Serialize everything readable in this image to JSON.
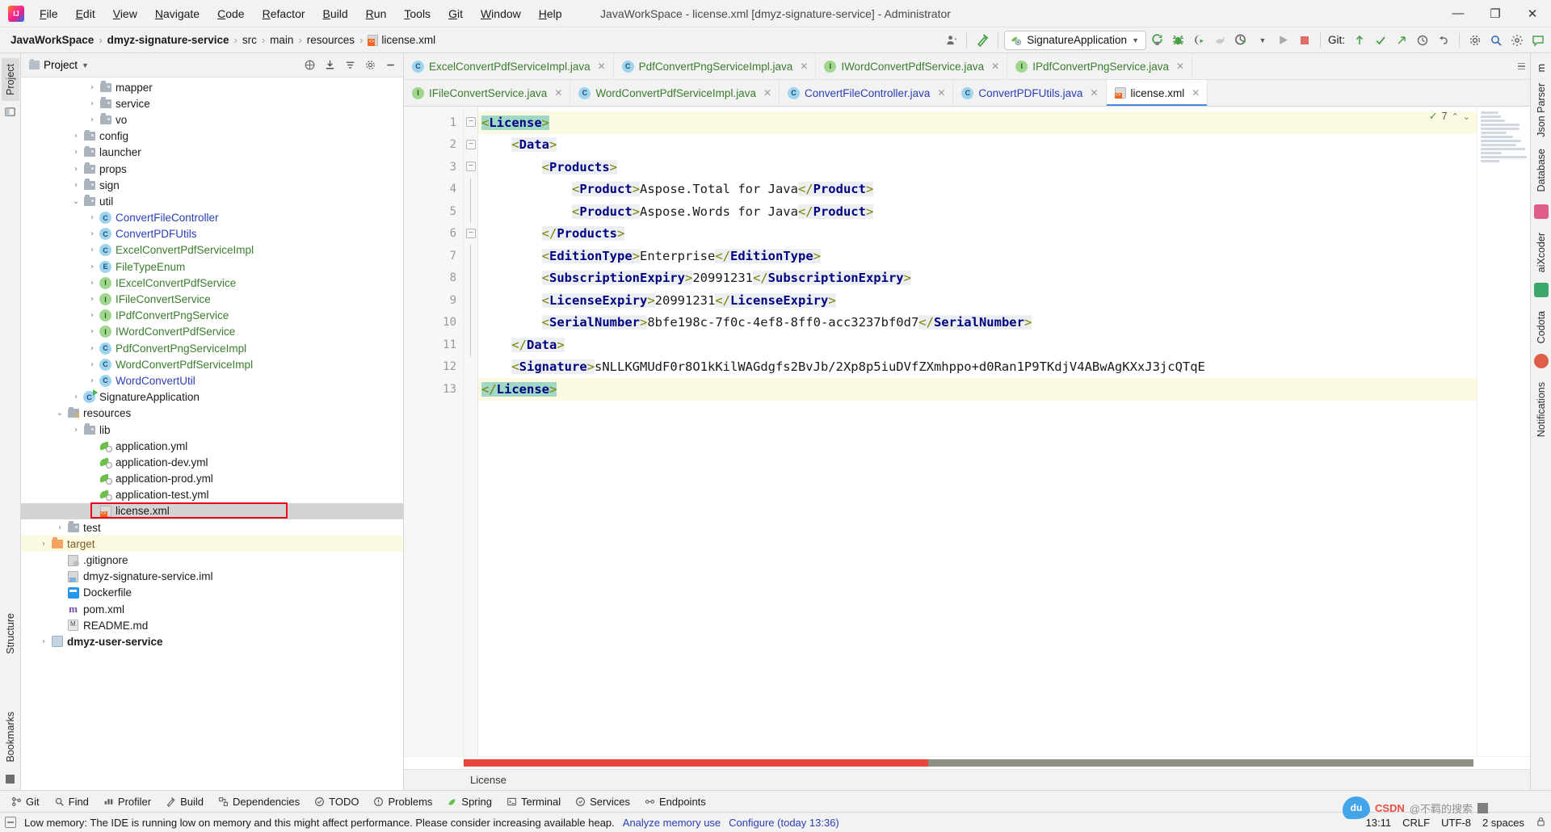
{
  "titlebar": {
    "logo_alt": "intellij-idea-logo",
    "window_title": "JavaWorkSpace - license.xml [dmyz-signature-service] - Administrator",
    "menus": [
      {
        "label": "File"
      },
      {
        "label": "Edit"
      },
      {
        "label": "View"
      },
      {
        "label": "Navigate"
      },
      {
        "label": "Code"
      },
      {
        "label": "Refactor"
      },
      {
        "label": "Build"
      },
      {
        "label": "Run"
      },
      {
        "label": "Tools"
      },
      {
        "label": "Git"
      },
      {
        "label": "Window"
      },
      {
        "label": "Help"
      }
    ],
    "window_buttons": {
      "minimize": "—",
      "maximize": "❐",
      "close": "✕"
    }
  },
  "navbar": {
    "breadcrumbs": [
      {
        "label": "JavaWorkSpace",
        "bold": true
      },
      {
        "label": "dmyz-signature-service",
        "bold": true
      },
      {
        "label": "src",
        "bold": false
      },
      {
        "label": "main",
        "bold": false
      },
      {
        "label": "resources",
        "bold": false
      },
      {
        "label": "license.xml",
        "bold": false,
        "icon": "xml-file-icon"
      }
    ],
    "separator": "›",
    "run_config": "SignatureApplication",
    "git_label": "Git:",
    "icons": [
      "user-avatar-icon",
      "hammer-build-icon",
      "rerun-icon",
      "debug-bug-icon",
      "coverage-icon",
      "profiler-icon",
      "run-with-dropdown-icon",
      "run-icon",
      "stop-icon",
      "git-update-icon",
      "git-commit-icon",
      "git-push-icon",
      "history-icon",
      "undo-icon",
      "settings-gear-icon",
      "search-everywhere-icon",
      "ide-settings-icon",
      "feedback-icon"
    ]
  },
  "left_strip": {
    "tabs": [
      {
        "label": "Project",
        "selected": true,
        "icon": "project-icon"
      },
      {
        "label": "Bookmarks",
        "selected": false,
        "icon": "bookmark-icon"
      },
      {
        "label": "Structure",
        "selected": false,
        "icon": "structure-icon"
      }
    ]
  },
  "right_strip": {
    "tabs": [
      {
        "label": "m",
        "icon": "maven-icon"
      },
      {
        "label": "Json Parser",
        "icon": "json-parser-icon"
      },
      {
        "label": "Database",
        "icon": "database-icon"
      },
      {
        "label": "aiXcoder",
        "icon": "aixcoder-icon"
      },
      {
        "label": "Codota",
        "icon": "codota-icon"
      },
      {
        "label": "Notifications",
        "icon": "notifications-icon"
      }
    ]
  },
  "project_panel": {
    "title": "Project",
    "header_icons": [
      "collapse-all-icon",
      "expand-all-icon",
      "sort-icon",
      "settings-gear-icon",
      "hide-icon"
    ],
    "tree": [
      {
        "depth": 4,
        "arrow": "›",
        "icon": "folder-icon",
        "label": "mapper",
        "color": ""
      },
      {
        "depth": 4,
        "arrow": "›",
        "icon": "folder-icon",
        "label": "service",
        "color": ""
      },
      {
        "depth": 4,
        "arrow": "›",
        "icon": "folder-icon",
        "label": "vo",
        "color": ""
      },
      {
        "depth": 3,
        "arrow": "›",
        "icon": "folder-icon",
        "label": "config",
        "color": ""
      },
      {
        "depth": 3,
        "arrow": "›",
        "icon": "folder-icon",
        "label": "launcher",
        "color": ""
      },
      {
        "depth": 3,
        "arrow": "›",
        "icon": "folder-icon",
        "label": "props",
        "color": ""
      },
      {
        "depth": 3,
        "arrow": "›",
        "icon": "folder-icon",
        "label": "sign",
        "color": ""
      },
      {
        "depth": 3,
        "arrow": "⌄",
        "icon": "folder-icon",
        "label": "util",
        "color": ""
      },
      {
        "depth": 4,
        "arrow": "›",
        "icon": "class-icon",
        "label": "ConvertFileController",
        "color": "blue"
      },
      {
        "depth": 4,
        "arrow": "›",
        "icon": "class-icon",
        "label": "ConvertPDFUtils",
        "color": "blue"
      },
      {
        "depth": 4,
        "arrow": "›",
        "icon": "class-icon",
        "label": "ExcelConvertPdfServiceImpl",
        "color": "green"
      },
      {
        "depth": 4,
        "arrow": "›",
        "icon": "enum-icon",
        "label": "FileTypeEnum",
        "color": "green"
      },
      {
        "depth": 4,
        "arrow": "›",
        "icon": "interface-icon",
        "label": "IExcelConvertPdfService",
        "color": "green"
      },
      {
        "depth": 4,
        "arrow": "›",
        "icon": "interface-icon",
        "label": "IFileConvertService",
        "color": "green"
      },
      {
        "depth": 4,
        "arrow": "›",
        "icon": "interface-icon",
        "label": "IPdfConvertPngService",
        "color": "green"
      },
      {
        "depth": 4,
        "arrow": "›",
        "icon": "interface-icon",
        "label": "IWordConvertPdfService",
        "color": "green"
      },
      {
        "depth": 4,
        "arrow": "›",
        "icon": "class-icon",
        "label": "PdfConvertPngServiceImpl",
        "color": "green"
      },
      {
        "depth": 4,
        "arrow": "›",
        "icon": "class-icon",
        "label": "WordConvertPdfServiceImpl",
        "color": "green"
      },
      {
        "depth": 4,
        "arrow": "›",
        "icon": "class-icon",
        "label": "WordConvertUtil",
        "color": "blue"
      },
      {
        "depth": 3,
        "arrow": "›",
        "icon": "runnable-class-icon",
        "label": "SignatureApplication",
        "color": ""
      },
      {
        "depth": 2,
        "arrow": "⌄",
        "icon": "resources-folder-icon",
        "label": "resources",
        "color": ""
      },
      {
        "depth": 3,
        "arrow": "›",
        "icon": "folder-icon",
        "label": "lib",
        "color": ""
      },
      {
        "depth": 4,
        "arrow": "",
        "icon": "yml-icon",
        "label": "application.yml",
        "color": ""
      },
      {
        "depth": 4,
        "arrow": "",
        "icon": "yml-icon",
        "label": "application-dev.yml",
        "color": ""
      },
      {
        "depth": 4,
        "arrow": "",
        "icon": "yml-icon",
        "label": "application-prod.yml",
        "color": ""
      },
      {
        "depth": 4,
        "arrow": "",
        "icon": "yml-icon",
        "label": "application-test.yml",
        "color": ""
      },
      {
        "depth": 4,
        "arrow": "",
        "icon": "xml-file-icon",
        "label": "license.xml",
        "color": "",
        "selected": true,
        "highlight_box": true
      },
      {
        "depth": 2,
        "arrow": "›",
        "icon": "folder-icon",
        "label": "test",
        "color": ""
      },
      {
        "depth": 1,
        "arrow": "›",
        "icon": "target-folder-icon",
        "label": "target",
        "color": "orange",
        "row_highlight": true
      },
      {
        "depth": 2,
        "arrow": "",
        "icon": "gitignore-icon",
        "label": ".gitignore",
        "color": ""
      },
      {
        "depth": 2,
        "arrow": "",
        "icon": "iml-icon",
        "label": "dmyz-signature-service.iml",
        "color": ""
      },
      {
        "depth": 2,
        "arrow": "",
        "icon": "docker-icon",
        "label": "Dockerfile",
        "color": ""
      },
      {
        "depth": 2,
        "arrow": "",
        "icon": "maven-pom-icon",
        "label": "pom.xml",
        "color": ""
      },
      {
        "depth": 2,
        "arrow": "",
        "icon": "markdown-icon",
        "label": "README.md",
        "color": ""
      },
      {
        "depth": 1,
        "arrow": "›",
        "icon": "module-icon",
        "label": "dmyz-user-service",
        "color": "",
        "bold": true
      }
    ]
  },
  "editor": {
    "tabs_row1": [
      {
        "label": "ExcelConvertPdfServiceImpl.java",
        "icon": "class-icon",
        "icon_kind": "c",
        "color": "green",
        "active": false
      },
      {
        "label": "PdfConvertPngServiceImpl.java",
        "icon": "class-icon",
        "icon_kind": "c",
        "color": "green",
        "active": false
      },
      {
        "label": "IWordConvertPdfService.java",
        "icon": "interface-icon",
        "icon_kind": "i",
        "color": "green",
        "active": false
      },
      {
        "label": "IPdfConvertPngService.java",
        "icon": "interface-icon",
        "icon_kind": "i",
        "color": "green",
        "active": false
      }
    ],
    "tabs_row2": [
      {
        "label": "IFileConvertService.java",
        "icon": "interface-icon",
        "icon_kind": "i",
        "color": "green",
        "active": false
      },
      {
        "label": "WordConvertPdfServiceImpl.java",
        "icon": "class-icon",
        "icon_kind": "c",
        "color": "green",
        "active": false
      },
      {
        "label": "ConvertFileController.java",
        "icon": "class-icon",
        "icon_kind": "c",
        "color": "blue",
        "active": false
      },
      {
        "label": "ConvertPDFUtils.java",
        "icon": "class-icon",
        "icon_kind": "c",
        "color": "blue",
        "active": false
      },
      {
        "label": "license.xml",
        "icon": "xml-file-icon",
        "icon_kind": "x",
        "color": "dark",
        "active": true
      }
    ],
    "inspection_count": "7",
    "inspection_ok": "✓",
    "lines": [
      {
        "n": "1",
        "indent": 0,
        "fold": true,
        "segments": [
          {
            "t": "<License>",
            "cls": "tag-green"
          }
        ],
        "highlight": true
      },
      {
        "n": "2",
        "indent": 1,
        "fold": true,
        "segments": [
          {
            "t": "<Data>",
            "cls": "tag"
          }
        ]
      },
      {
        "n": "3",
        "indent": 2,
        "fold": true,
        "segments": [
          {
            "t": "<Products>",
            "cls": "tag"
          }
        ]
      },
      {
        "n": "4",
        "indent": 3,
        "fold": false,
        "segments": [
          {
            "t": "<Product>",
            "cls": "tag"
          },
          {
            "t": "Aspose.Total for Java",
            "cls": "txt"
          },
          {
            "t": "</Product>",
            "cls": "tag"
          }
        ]
      },
      {
        "n": "5",
        "indent": 3,
        "fold": false,
        "segments": [
          {
            "t": "<Product>",
            "cls": "tag"
          },
          {
            "t": "Aspose.Words for Java",
            "cls": "txt"
          },
          {
            "t": "</Product>",
            "cls": "tag"
          }
        ]
      },
      {
        "n": "6",
        "indent": 2,
        "fold": true,
        "segments": [
          {
            "t": "</Products>",
            "cls": "tag"
          }
        ]
      },
      {
        "n": "7",
        "indent": 2,
        "fold": false,
        "segments": [
          {
            "t": "<EditionType>",
            "cls": "tag"
          },
          {
            "t": "Enterprise",
            "cls": "txt"
          },
          {
            "t": "</EditionType>",
            "cls": "tag"
          }
        ]
      },
      {
        "n": "8",
        "indent": 2,
        "fold": false,
        "segments": [
          {
            "t": "<SubscriptionExpiry>",
            "cls": "tag"
          },
          {
            "t": "20991231",
            "cls": "txt"
          },
          {
            "t": "</SubscriptionExpiry>",
            "cls": "tag"
          }
        ]
      },
      {
        "n": "9",
        "indent": 2,
        "fold": false,
        "segments": [
          {
            "t": "<LicenseExpiry>",
            "cls": "tag"
          },
          {
            "t": "20991231",
            "cls": "txt"
          },
          {
            "t": "</LicenseExpiry>",
            "cls": "tag"
          }
        ]
      },
      {
        "n": "10",
        "indent": 2,
        "fold": false,
        "segments": [
          {
            "t": "<SerialNumber>",
            "cls": "tag"
          },
          {
            "t": "8bfe198c-7f0c-4ef8-8ff0-acc3237bf0d7",
            "cls": "txt"
          },
          {
            "t": "</SerialNumber>",
            "cls": "tag"
          }
        ]
      },
      {
        "n": "11",
        "indent": 1,
        "fold": false,
        "segments": [
          {
            "t": "</Data>",
            "cls": "tag"
          }
        ]
      },
      {
        "n": "12",
        "indent": 1,
        "fold": false,
        "bulb": true,
        "segments": [
          {
            "t": "<Signature>",
            "cls": "tag"
          },
          {
            "t": "sNLLKGMUdF0r8O1kKilWAGdgfs2BvJb/2Xp8p5iuDVfZXmhppo+d0Ran1P9TKdjV4ABwAgKXxJ3jcQTqE",
            "cls": "txt"
          }
        ]
      },
      {
        "n": "13",
        "indent": 0,
        "fold": false,
        "segments": [
          {
            "t": "</License>",
            "cls": "tag-green"
          }
        ],
        "highlight": true
      }
    ],
    "bottom_breadcrumb": "License"
  },
  "bottom_toolwindows": [
    {
      "label": "Git",
      "icon": "git-branch-icon"
    },
    {
      "label": "Find",
      "icon": "search-icon"
    },
    {
      "label": "Profiler",
      "icon": "profiler-icon"
    },
    {
      "label": "Build",
      "icon": "build-hammer-icon"
    },
    {
      "label": "Dependencies",
      "icon": "dependencies-icon"
    },
    {
      "label": "TODO",
      "icon": "todo-check-icon"
    },
    {
      "label": "Problems",
      "icon": "problems-warning-icon"
    },
    {
      "label": "Spring",
      "icon": "spring-leaf-icon"
    },
    {
      "label": "Terminal",
      "icon": "terminal-icon"
    },
    {
      "label": "Services",
      "icon": "services-icon"
    },
    {
      "label": "Endpoints",
      "icon": "endpoints-icon"
    }
  ],
  "statusbar": {
    "memory_icon": "memory-warning-icon",
    "message": "Low memory: The IDE is running low on memory and this might affect performance. Please consider increasing available heap.",
    "action_analyze": "Analyze memory use",
    "action_configure": "Configure (today 13:36)",
    "time": "13:11",
    "line_separator": "CRLF",
    "encoding": "UTF-8",
    "indent": "2 spaces",
    "lock_icon": "lock-icon"
  },
  "watermark": {
    "bubble": "du",
    "text_csdn": "CSDN",
    "text_cn": "@不羁的搜索",
    "block_icon": "block-icon"
  },
  "colors": {
    "accent_blue": "#4a89dc",
    "tag_navy": "#000080",
    "angle_olive": "#808000",
    "green_text": "#3a7d2c",
    "blue_text": "#2b40b5",
    "selection_gray": "#d4d4d4",
    "highlight_yellow": "#fdfae4",
    "red_box": "#e8001c",
    "scroll_red": "#e8453c"
  }
}
